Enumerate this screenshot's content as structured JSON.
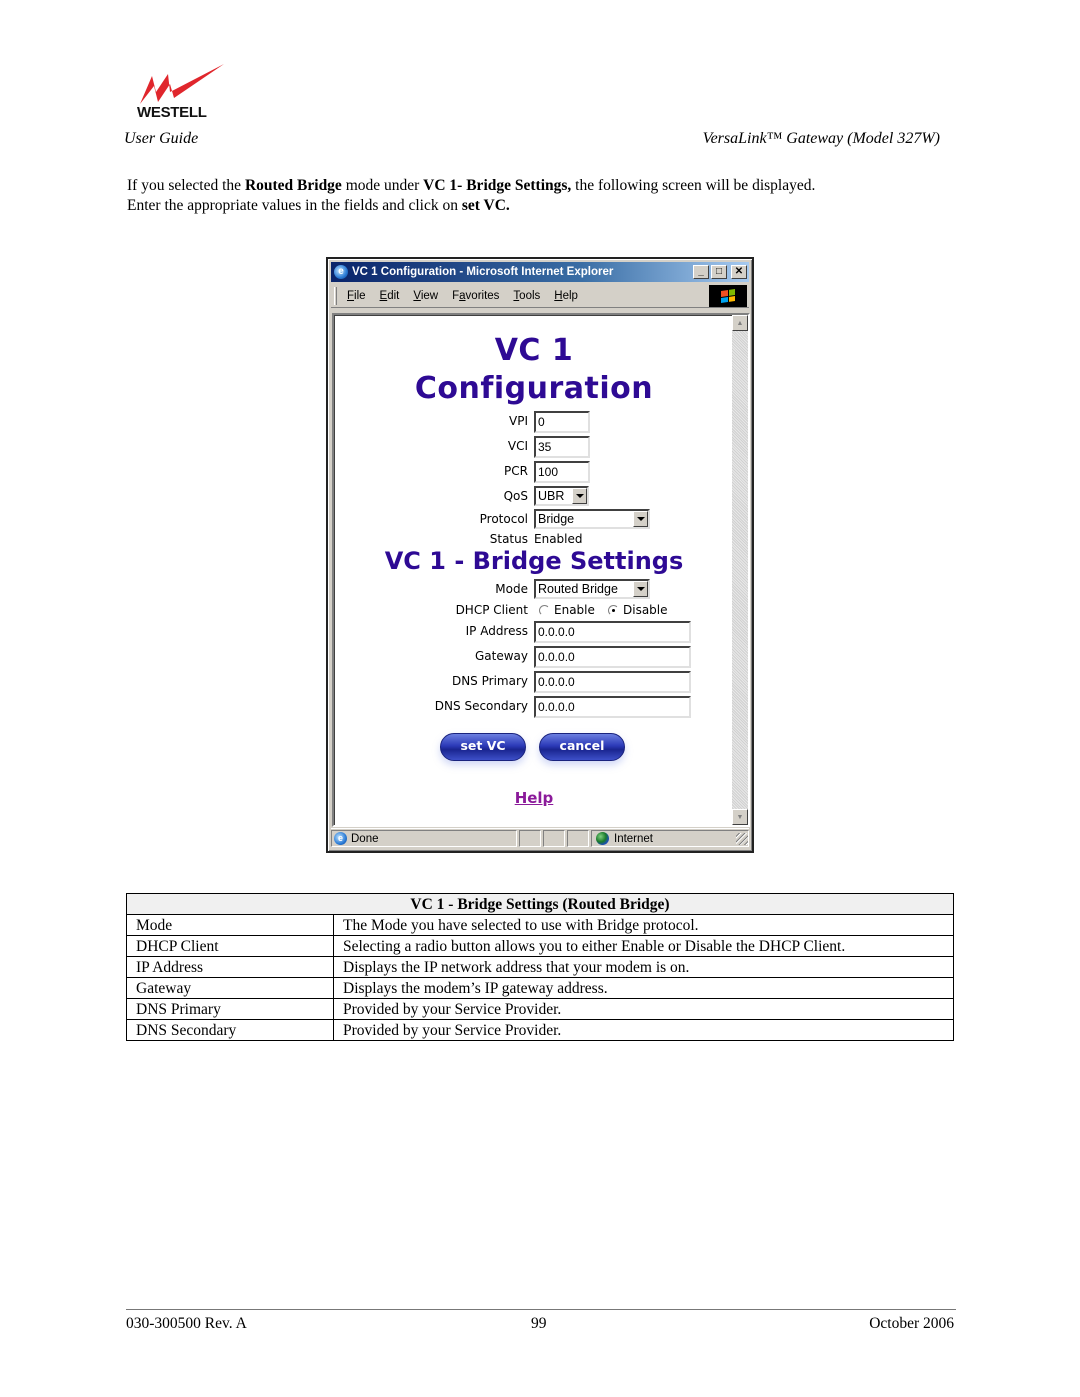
{
  "header": {
    "logo_text": "WESTELL",
    "logo_color": "#e0262c",
    "left": "User Guide",
    "right": "VersaLink™ Gateway (Model 327W)"
  },
  "intro": {
    "p1_a": "If you selected the ",
    "p1_b": "Routed Bridge",
    "p1_c": " mode under ",
    "p1_d": "VC 1- Bridge Settings,",
    "p1_e": " the following screen will be displayed.",
    "p2_a": "Enter the appropriate values in the fields and click on ",
    "p2_b": "set VC."
  },
  "browser": {
    "title": "VC 1 Configuration - Microsoft Internet Explorer",
    "title_icon": "e",
    "controls": {
      "minimize": "_",
      "maximize": "□",
      "close": "✕"
    },
    "menu": [
      {
        "u": "F",
        "rest": "ile"
      },
      {
        "u": "E",
        "rest": "dit"
      },
      {
        "u": "V",
        "rest": "iew"
      },
      {
        "pre": "F",
        "u": "a",
        "rest": "vorites"
      },
      {
        "u": "T",
        "rest": "ools"
      },
      {
        "u": "H",
        "rest": "elp"
      }
    ],
    "status": {
      "left": "Done",
      "zone": "Internet"
    },
    "page": {
      "title_line1": "VC 1",
      "title_line2": "Configuration",
      "fields": {
        "vpi": {
          "label": "VPI",
          "value": "0"
        },
        "vci": {
          "label": "VCI",
          "value": "35"
        },
        "pcr": {
          "label": "PCR",
          "value": "100"
        },
        "qos": {
          "label": "QoS",
          "value": "UBR"
        },
        "protocol": {
          "label": "Protocol",
          "value": "Bridge"
        },
        "status": {
          "label": "Status",
          "value": "Enabled"
        }
      },
      "bridge_title": "VC 1 - Bridge Settings",
      "bridge": {
        "mode": {
          "label": "Mode",
          "value": "Routed Bridge"
        },
        "dhcp": {
          "label": "DHCP Client",
          "opt_enable": "Enable",
          "opt_disable": "Disable",
          "selected": "Disable"
        },
        "ip": {
          "label": "IP Address",
          "value": "0.0.0.0"
        },
        "gateway": {
          "label": "Gateway",
          "value": "0.0.0.0"
        },
        "dns1": {
          "label": "DNS Primary",
          "value": "0.0.0.0"
        },
        "dns2": {
          "label": "DNS Secondary",
          "value": "0.0.0.0"
        }
      },
      "buttons": {
        "set": "set VC",
        "cancel": "cancel"
      },
      "help_link": "Help",
      "heading_color": "#2e0a94"
    }
  },
  "table": {
    "title": "VC 1 - Bridge Settings (Routed Bridge)",
    "rows": [
      {
        "name": "Mode",
        "desc": "The Mode you have selected to use with Bridge protocol."
      },
      {
        "name": "DHCP Client",
        "desc": "Selecting a radio button allows you to either Enable or Disable the DHCP Client."
      },
      {
        "name": "IP Address",
        "desc": "Displays the IP network address that your modem is on."
      },
      {
        "name": "Gateway",
        "desc": "Displays the modem’s IP gateway address."
      },
      {
        "name": "DNS Primary",
        "desc": "Provided by your Service Provider."
      },
      {
        "name": "DNS Secondary",
        "desc": "Provided by your Service Provider."
      }
    ]
  },
  "footer": {
    "left": "030-300500 Rev. A",
    "center": "99",
    "right": "October 2006"
  }
}
